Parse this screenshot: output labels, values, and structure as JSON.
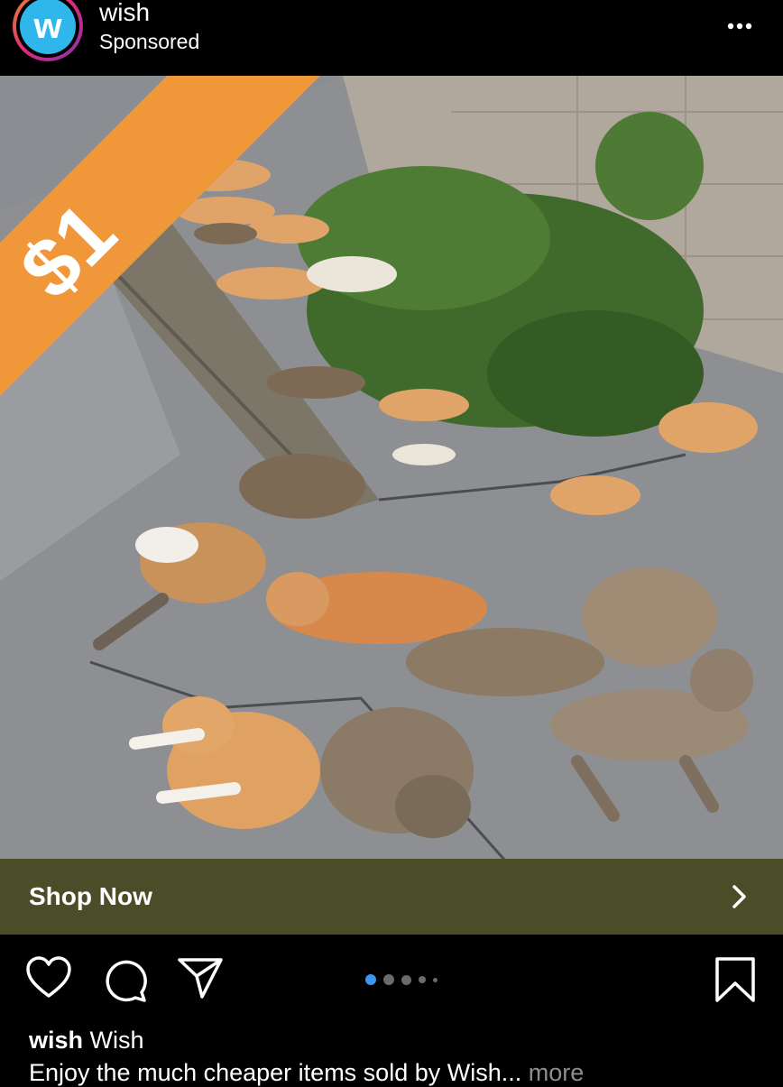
{
  "header": {
    "account_name": "wish",
    "subtitle": "Sponsored",
    "logo_letter": "w"
  },
  "post": {
    "price_tag": "$1",
    "cta_label": "Shop Now",
    "carousel": {
      "count": 5,
      "active_index": 0
    }
  },
  "caption": {
    "username": "wish",
    "display_name": "Wish",
    "text": "Enjoy the much cheaper items sold by Wish...",
    "more_label": "more"
  },
  "colors": {
    "background": "#000000",
    "ribbon": "#f0973a",
    "cta_bar": "#4a4d27",
    "logo_blue": "#2fb7ec",
    "active_dot": "#3897f0"
  },
  "icons": [
    "more-dots-icon",
    "chevron-right-icon",
    "heart-icon",
    "comment-icon",
    "send-icon",
    "bookmark-icon"
  ]
}
